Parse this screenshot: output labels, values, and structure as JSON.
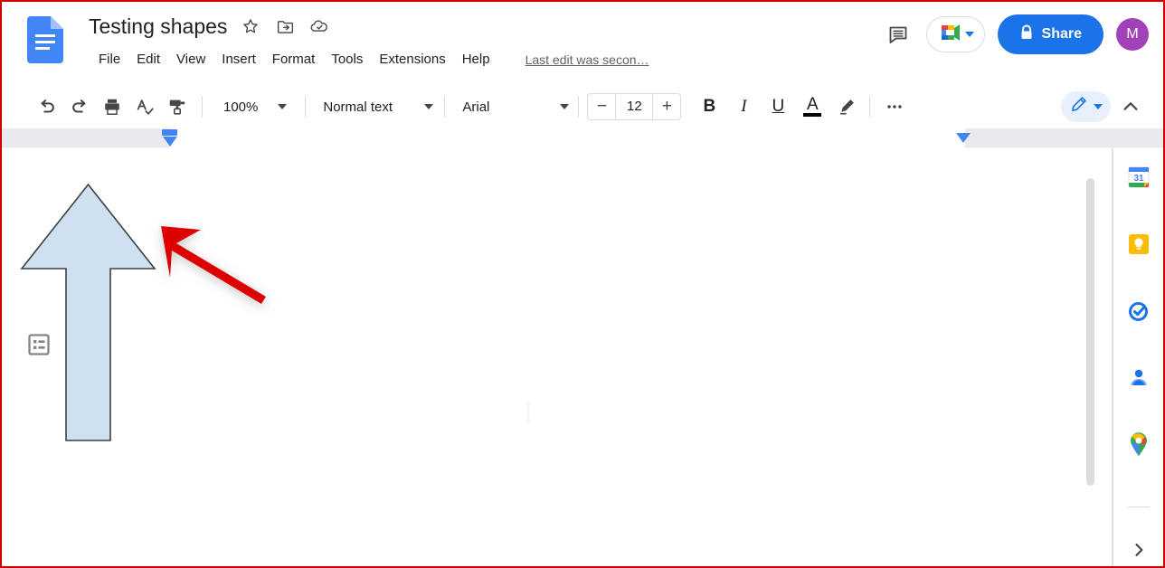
{
  "header": {
    "doc_icon": "google-docs-icon",
    "title": "Testing shapes",
    "title_icons": [
      {
        "name": "star-icon",
        "label": "Star"
      },
      {
        "name": "move-to-folder-icon",
        "label": "Move"
      },
      {
        "name": "cloud-saved-icon",
        "label": "Saved to Drive"
      }
    ],
    "menu": [
      {
        "name": "file",
        "label": "File"
      },
      {
        "name": "edit",
        "label": "Edit"
      },
      {
        "name": "view",
        "label": "View"
      },
      {
        "name": "insert",
        "label": "Insert"
      },
      {
        "name": "format",
        "label": "Format"
      },
      {
        "name": "tools",
        "label": "Tools"
      },
      {
        "name": "extensions",
        "label": "Extensions"
      },
      {
        "name": "help",
        "label": "Help"
      }
    ],
    "last_edit": "Last edit was secon…",
    "comment_icon": "comment-icon",
    "meet_icon": "google-meet-icon",
    "share_label": "Share",
    "share_icon": "lock-icon",
    "avatar_initial": "M",
    "avatar_color": "#a142b8",
    "share_color": "#1a73e8"
  },
  "toolbar": {
    "undo": "undo-icon",
    "redo": "redo-icon",
    "print": "print-icon",
    "spellcheck": "spellcheck-icon",
    "paint_format": "paint-format-icon",
    "zoom_value": "100%",
    "style_value": "Normal text",
    "font_value": "Arial",
    "font_size_minus": "−",
    "font_size_value": "12",
    "font_size_plus": "+",
    "bold": "B",
    "italic": "I",
    "underline": "U",
    "text_color": "A",
    "highlight": "highlight-pen-icon",
    "more": "more-options-icon",
    "mode_icon": "pencil-edit-icon",
    "collapse": "collapse-toolbar-icon"
  },
  "ruler": {
    "left_indent": "left-indent-marker",
    "right_indent": "right-indent-marker"
  },
  "document": {
    "outline_icon": "document-outline-icon",
    "shapes": [
      {
        "name": "up-arrow-shape",
        "fill": "#cfe0f0",
        "stroke": "#3c4043"
      },
      {
        "name": "red-annotation-arrow",
        "fill": "#dd0000"
      }
    ],
    "cursor": "text-ibeam-cursor"
  },
  "sidebar": {
    "items": [
      {
        "name": "google-calendar-icon",
        "label": "Calendar",
        "badge": "31"
      },
      {
        "name": "google-keep-icon",
        "label": "Keep"
      },
      {
        "name": "google-tasks-icon",
        "label": "Tasks"
      },
      {
        "name": "google-contacts-icon",
        "label": "Contacts"
      },
      {
        "name": "google-maps-icon",
        "label": "Maps"
      }
    ],
    "expand_icon": "expand-side-panel-icon"
  }
}
